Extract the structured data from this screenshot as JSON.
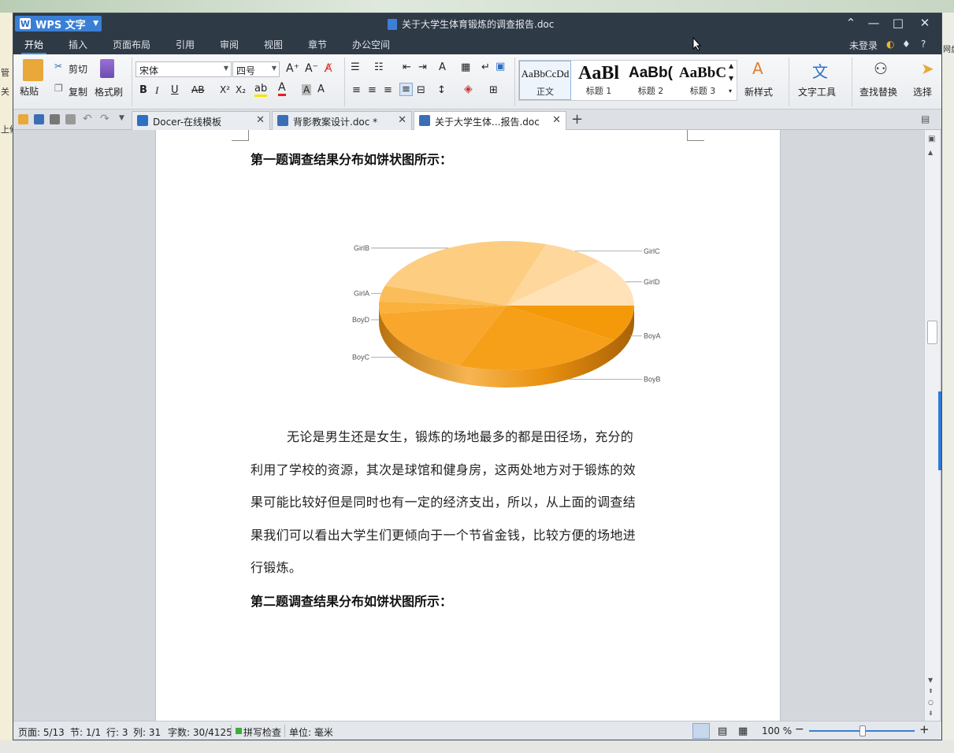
{
  "background": {
    "left_texts": [
      "管",
      "上修",
      "关"
    ],
    "right_text": "网盘"
  },
  "app": {
    "name": "WPS 文字",
    "window_title": "关于大学生体育锻炼的调查报告.doc"
  },
  "menu": {
    "tabs": [
      "开始",
      "插入",
      "页面布局",
      "引用",
      "审阅",
      "视图",
      "章节",
      "办公空间"
    ],
    "active": "开始",
    "login": "未登录",
    "help": "?"
  },
  "ribbon": {
    "paste": "粘贴",
    "cut": "剪切",
    "copy": "复制",
    "format_painter": "格式刷",
    "font_name": "宋体",
    "font_size": "四号",
    "styles": [
      {
        "preview": "AaBbCcDd",
        "label": "正文"
      },
      {
        "preview": "AaBl",
        "label": "标题 1"
      },
      {
        "preview": "AaBb(",
        "label": "标题 2"
      },
      {
        "preview": "AaBbC",
        "label": "标题 3"
      }
    ],
    "new_style": "新样式",
    "text_tools": "文字工具",
    "find_replace": "查找替换",
    "select": "选择"
  },
  "tabs": [
    {
      "label": "Docer-在线模板",
      "icon": "docer-icon"
    },
    {
      "label": "背影教案设计.doc *",
      "icon": "doc-icon"
    },
    {
      "label": "关于大学生体...报告.doc",
      "icon": "doc-icon",
      "active": true
    }
  ],
  "document": {
    "heading1": "第一题调查结果分布如饼状图所示：",
    "paragraph_lines": [
      "无论是男生还是女生，锻炼的场地最多的都是田径场，充分的",
      "利用了学校的资源，其次是球馆和健身房，这两处地方对于锻炼的效",
      "果可能比较好但是同时也有一定的经济支出，所以，从上面的调查结",
      "果我们可以看出大学生们更倾向于一个节省金钱，比较方便的场地进",
      "行锻炼。"
    ],
    "heading2": "第二题调查结果分布如饼状图所示："
  },
  "chart_data": {
    "type": "pie",
    "title": "",
    "categories": [
      "BoyA",
      "BoyB",
      "BoyC",
      "BoyD",
      "GirlA",
      "GirlB",
      "GirlC",
      "GirlD"
    ],
    "values": [
      9,
      22,
      17,
      3,
      4,
      25,
      8,
      12
    ],
    "colors": [
      "#f49a0a",
      "#f6a01a",
      "#f8a72c",
      "#fab23c",
      "#fbbd59",
      "#fdcd82",
      "#fed79c",
      "#ffe2b8"
    ],
    "labels_shown": true,
    "style": "3d"
  },
  "status": {
    "page": "页面: 5/13",
    "section": "节: 1/1",
    "row": "行: 3",
    "col": "列: 31",
    "words": "字数: 30/4125",
    "spell": "拼写检查",
    "unit": "单位: 毫米",
    "zoom": "100 %"
  }
}
